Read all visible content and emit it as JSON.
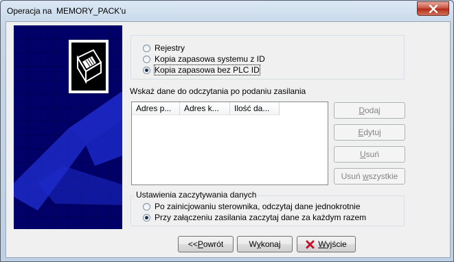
{
  "window": {
    "title": "Operacja na  MEMORY_PACK'u"
  },
  "data_source": {
    "options": [
      {
        "label": "Rejestry",
        "checked": false
      },
      {
        "label": "Kopia zapasowa systemu z ID",
        "checked": false
      },
      {
        "label": "Kopia zapasowa bez PLC ID",
        "checked": true
      }
    ]
  },
  "read_section": {
    "label": "Wskaż dane do odczytania po podaniu zasilania",
    "columns": [
      "Adres p...",
      "Adres k...",
      "Ilość da..."
    ],
    "rows": []
  },
  "side_buttons": {
    "add": {
      "pre": "",
      "u": "D",
      "post": "odaj",
      "enabled": false
    },
    "edit": {
      "pre": "",
      "u": "E",
      "post": "dytuj",
      "enabled": false
    },
    "remove": {
      "pre": "",
      "u": "U",
      "post": "suń",
      "enabled": false
    },
    "remove_all": {
      "pre": "Usuń ",
      "u": "w",
      "post": "szystkie",
      "enabled": false
    }
  },
  "load_settings": {
    "caption": "Ustawienia zaczytywania danych",
    "options": [
      {
        "label": "Po zainicjowaniu sterownika, odczytaj dane jednokrotnie",
        "checked": false
      },
      {
        "label": "Przy załączeniu zasilania zaczytaj dane za każdym razem",
        "checked": true
      }
    ]
  },
  "footer": {
    "back": {
      "pre": "<<",
      "u": "P",
      "post": "owrót"
    },
    "execute": {
      "pre": "W",
      "u": "y",
      "post": "konaj"
    },
    "exit": {
      "pre": "",
      "u": "W",
      "post": "yjście"
    }
  },
  "colors": {
    "banner_bg": "#000068",
    "banner_shape": "#1e2ccc",
    "exit_icon": "#c0142a"
  },
  "icons": {
    "close": "close-icon",
    "exit": "x-icon",
    "logo": "memory-pack-logo"
  }
}
